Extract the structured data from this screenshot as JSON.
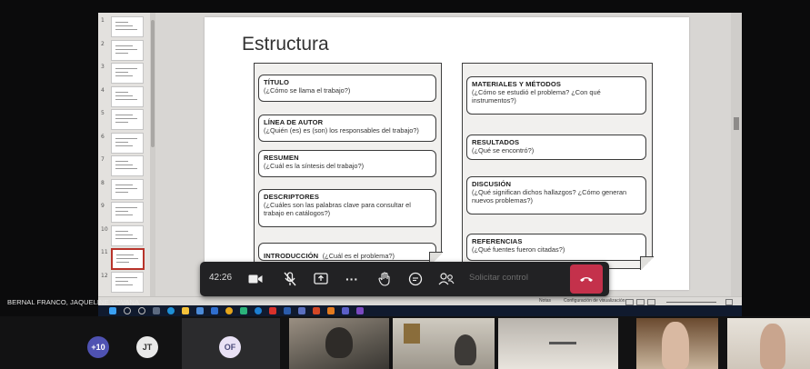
{
  "slide": {
    "title": "Estructura",
    "left_cards": [
      {
        "heading": "TÍTULO",
        "question": "(¿Cómo se llama el trabajo?)"
      },
      {
        "heading": "LÍNEA DE AUTOR",
        "question": "(¿Quién (es) es (son) los responsables del trabajo?)"
      },
      {
        "heading": "RESUMEN",
        "question": "(¿Cuál es la síntesis del trabajo?)"
      },
      {
        "heading": "DESCRIPTORES",
        "question": "(¿Cuáles son las palabras clave para consultar el trabajo en catálogos?)"
      },
      {
        "heading": "INTRODUCCIÓN",
        "question": "(¿Cuál es el problema?)"
      }
    ],
    "right_cards": [
      {
        "heading": "MATERIALES Y MÉTODOS",
        "question": "(¿Cómo se estudió el problema? ¿Con qué instrumentos?)"
      },
      {
        "heading": "RESULTADOS",
        "question": "(¿Qué se encontró?)"
      },
      {
        "heading": "DISCUSIÓN",
        "question": "(¿Qué significan dichos hallazgos? ¿Cómo generan nuevos problemas?)"
      },
      {
        "heading": "REFERENCIAS",
        "question": "(¿Qué fuentes fueron citadas?)"
      }
    ]
  },
  "thumbnails": {
    "numbers": [
      "1",
      "2",
      "3",
      "4",
      "5",
      "6",
      "7",
      "8",
      "9",
      "10",
      "11",
      "12"
    ],
    "selected_index": 10
  },
  "call": {
    "timer": "42:26",
    "request_control_label": "Solicitar control",
    "icons": [
      "video-camera-icon",
      "mic-off-icon",
      "share-screen-icon",
      "more-icon",
      "raise-hand-icon",
      "chat-icon",
      "participants-icon",
      "hang-up-icon"
    ],
    "presenter_name": "BERNAL FRANCO, JAQUELINE YOVANA",
    "hangup_color": "#c4314b"
  },
  "statusbar": {
    "notes_label": "Notas",
    "display_label": "Configuración de visualización"
  },
  "participants": {
    "overflow": "+10",
    "avatars": [
      {
        "initials": "JT",
        "bg": "#e8e8e8",
        "fg": "#333333"
      },
      {
        "initials": "OF",
        "bg": "#e9e1f5",
        "fg": "#4b4b7a"
      }
    ],
    "overflow_bg": "#4f52b2"
  }
}
